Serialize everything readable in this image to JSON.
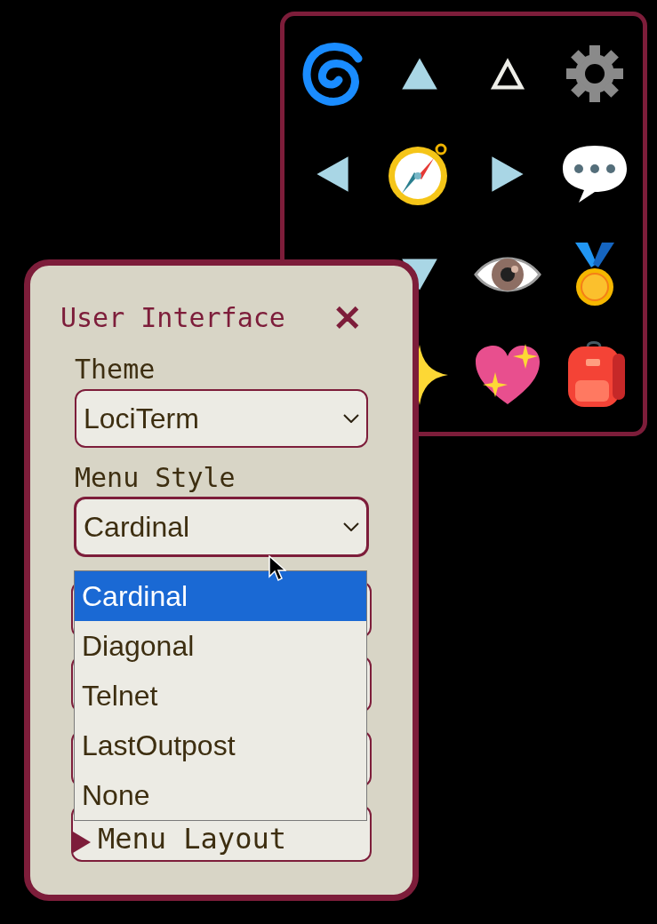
{
  "dialog": {
    "title": "User Interface",
    "close": "✕",
    "fields": [
      {
        "label": "Theme",
        "value": "LociTerm",
        "expanded": false
      },
      {
        "label": "Menu Style",
        "value": "Cardinal",
        "expanded": true
      }
    ],
    "dropdown": [
      {
        "label": "Cardinal",
        "selected": true
      },
      {
        "label": "Diagonal",
        "selected": false
      },
      {
        "label": "Telnet",
        "selected": false
      },
      {
        "label": "LastOutpost",
        "selected": false
      },
      {
        "label": "None",
        "selected": false
      }
    ],
    "buttons": [
      {
        "label": "Menu Layout"
      }
    ]
  }
}
